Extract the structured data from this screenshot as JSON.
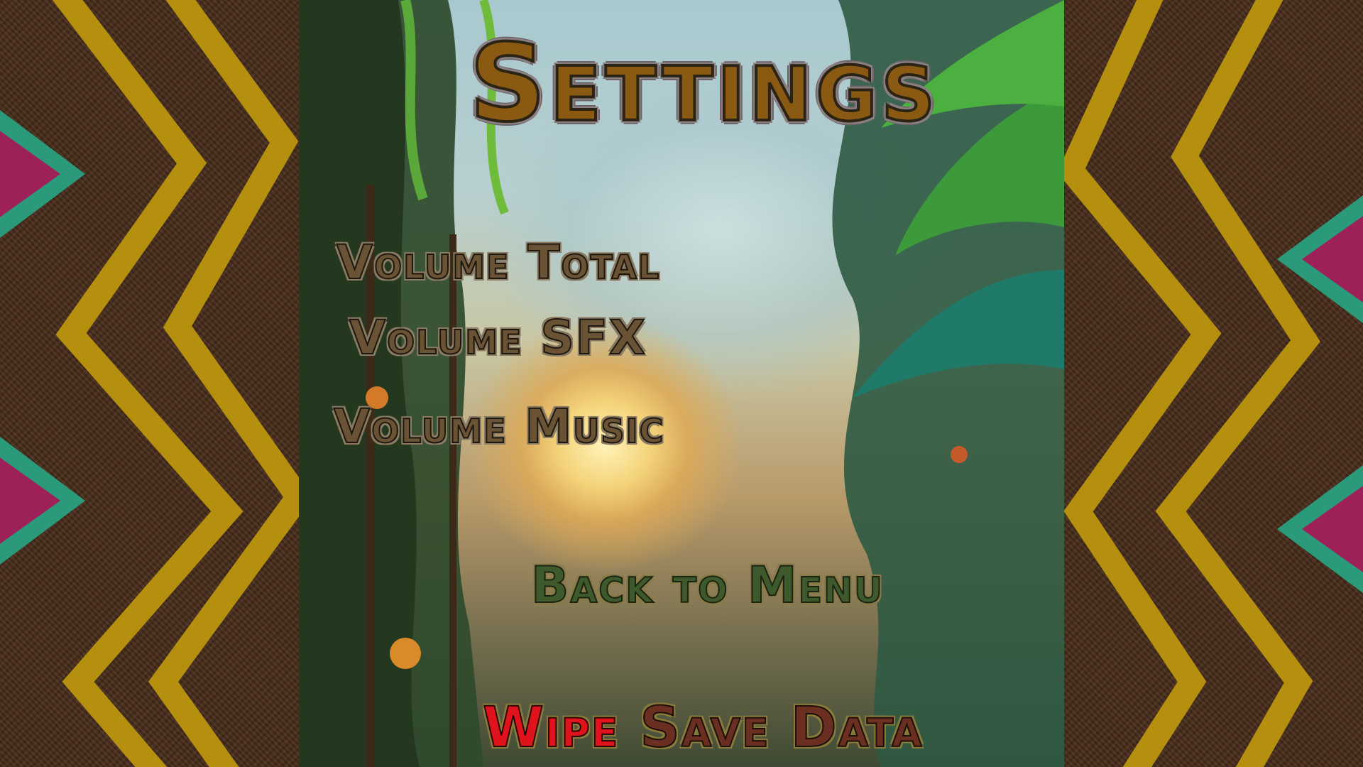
{
  "screen": {
    "title": "Settings"
  },
  "menu": {
    "volume_total": "Volume Total",
    "volume_sfx": "Volume SFX",
    "volume_music": "Volume Music",
    "back_to_menu": "Back to Menu",
    "wipe_save_data": {
      "warning_word": "Wipe",
      "rest": " Save Data"
    }
  },
  "colors": {
    "title_fill": "#8a5a12",
    "panel_brown": "#4b2f1d",
    "zigzag_yellow": "#b5900e",
    "diamond_magenta": "#9e2059",
    "diamond_teal": "#2a9a7a",
    "wipe_warning_red": "#e0121b"
  }
}
